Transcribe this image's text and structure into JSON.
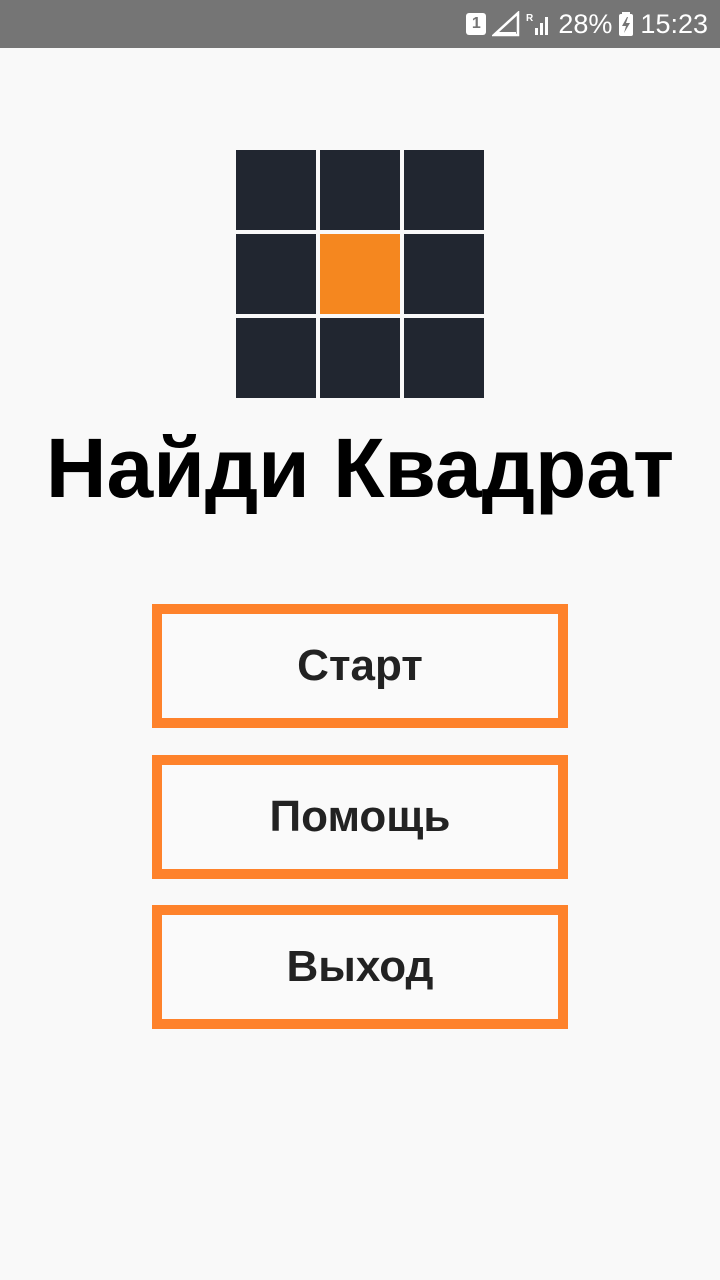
{
  "status_bar": {
    "sim_slot": "1",
    "battery_percent": "28%",
    "time": "15:23",
    "icons": [
      "sim-slot-icon",
      "no-signal-icon",
      "roaming-signal-icon",
      "battery-charging-icon"
    ]
  },
  "logo": {
    "cells": [
      "dark",
      "dark",
      "dark",
      "dark",
      "orange",
      "dark",
      "dark",
      "dark",
      "dark"
    ],
    "colors": {
      "dark": "#212630",
      "orange": "#f5871f"
    }
  },
  "title": "Найди Квадрат",
  "menu": {
    "start_label": "Старт",
    "help_label": "Помощь",
    "exit_label": "Выход",
    "border_color": "#fe822b"
  }
}
